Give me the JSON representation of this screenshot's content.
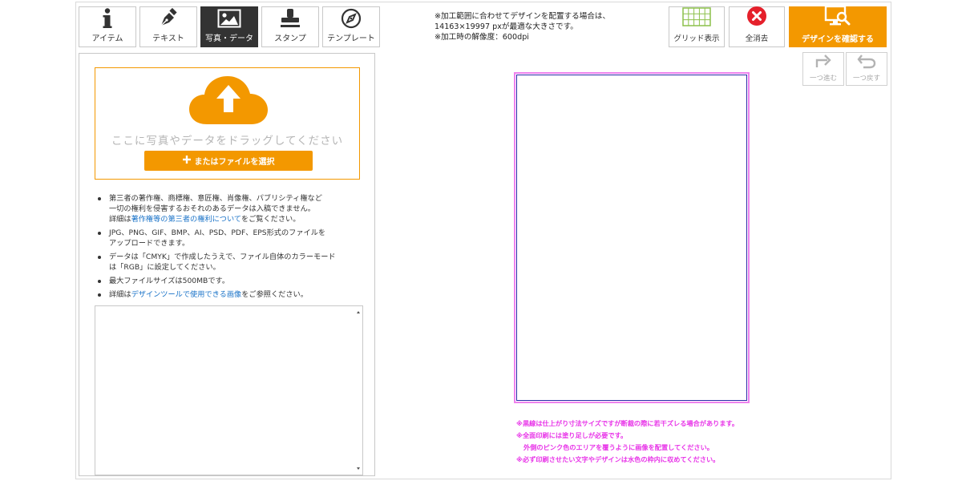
{
  "tools": {
    "item": "アイテム",
    "text": "テキスト",
    "photo": "写真・データ",
    "stamp": "スタンプ",
    "template": "テンプレート"
  },
  "upload": {
    "drag_text": "ここに写真やデータをドラッグしてください",
    "file_button": "またはファイルを選択"
  },
  "notes": {
    "n1_line1": "第三者の著作権、商標権、意匠権、肖像権、パブリシティ権など",
    "n1_line2": "一切の権利を侵害するおそれのあるデータは入稿できません。",
    "n1_prefix": "詳細は",
    "n1_link": "著作権等の第三者の権利について",
    "n1_suffix": "をご覧ください。",
    "n2_line1": "JPG、PNG、GIF、BMP、AI、PSD、PDF、EPS形式のファイルを",
    "n2_line2": "アップロードできます。",
    "n3_line1": "データは「CMYK」で作成したうえで、ファイル自体のカラーモード",
    "n3_line2": "は「RGB」に設定してください。",
    "n4": "最大ファイルサイズは500MBです。",
    "n5_prefix": "詳細は",
    "n5_link": "デザインツールで使用できる画像",
    "n5_suffix": "をご参照ください。"
  },
  "info": {
    "line1": "※加工範囲に合わせてデザインを配置する場合は、",
    "line2": "14163×19997 pxが最適な大きさです。",
    "line3": "※加工時の解像度：600dpi"
  },
  "buttons": {
    "grid": "グリッド表示",
    "clear": "全消去",
    "confirm": "デザインを確認する",
    "redo": "一つ進む",
    "undo": "一つ戻す"
  },
  "warnings": {
    "w1": "※黒線は仕上がり寸法サイズですが断裁の際に若干ズレる場合があります。",
    "w2": "※全面印刷には塗り足しが必要です。",
    "w3": "外側のピンク色のエリアを覆うように画像を配置してください。",
    "w4": "※必ず印刷させたい文字やデザインは水色の枠内に収めてください。"
  },
  "colors": {
    "accent": "#f39800",
    "link": "#1a73c8",
    "warning": "#e835e8",
    "bleed": "#ee82ee",
    "trim": "#2a2aa8"
  }
}
